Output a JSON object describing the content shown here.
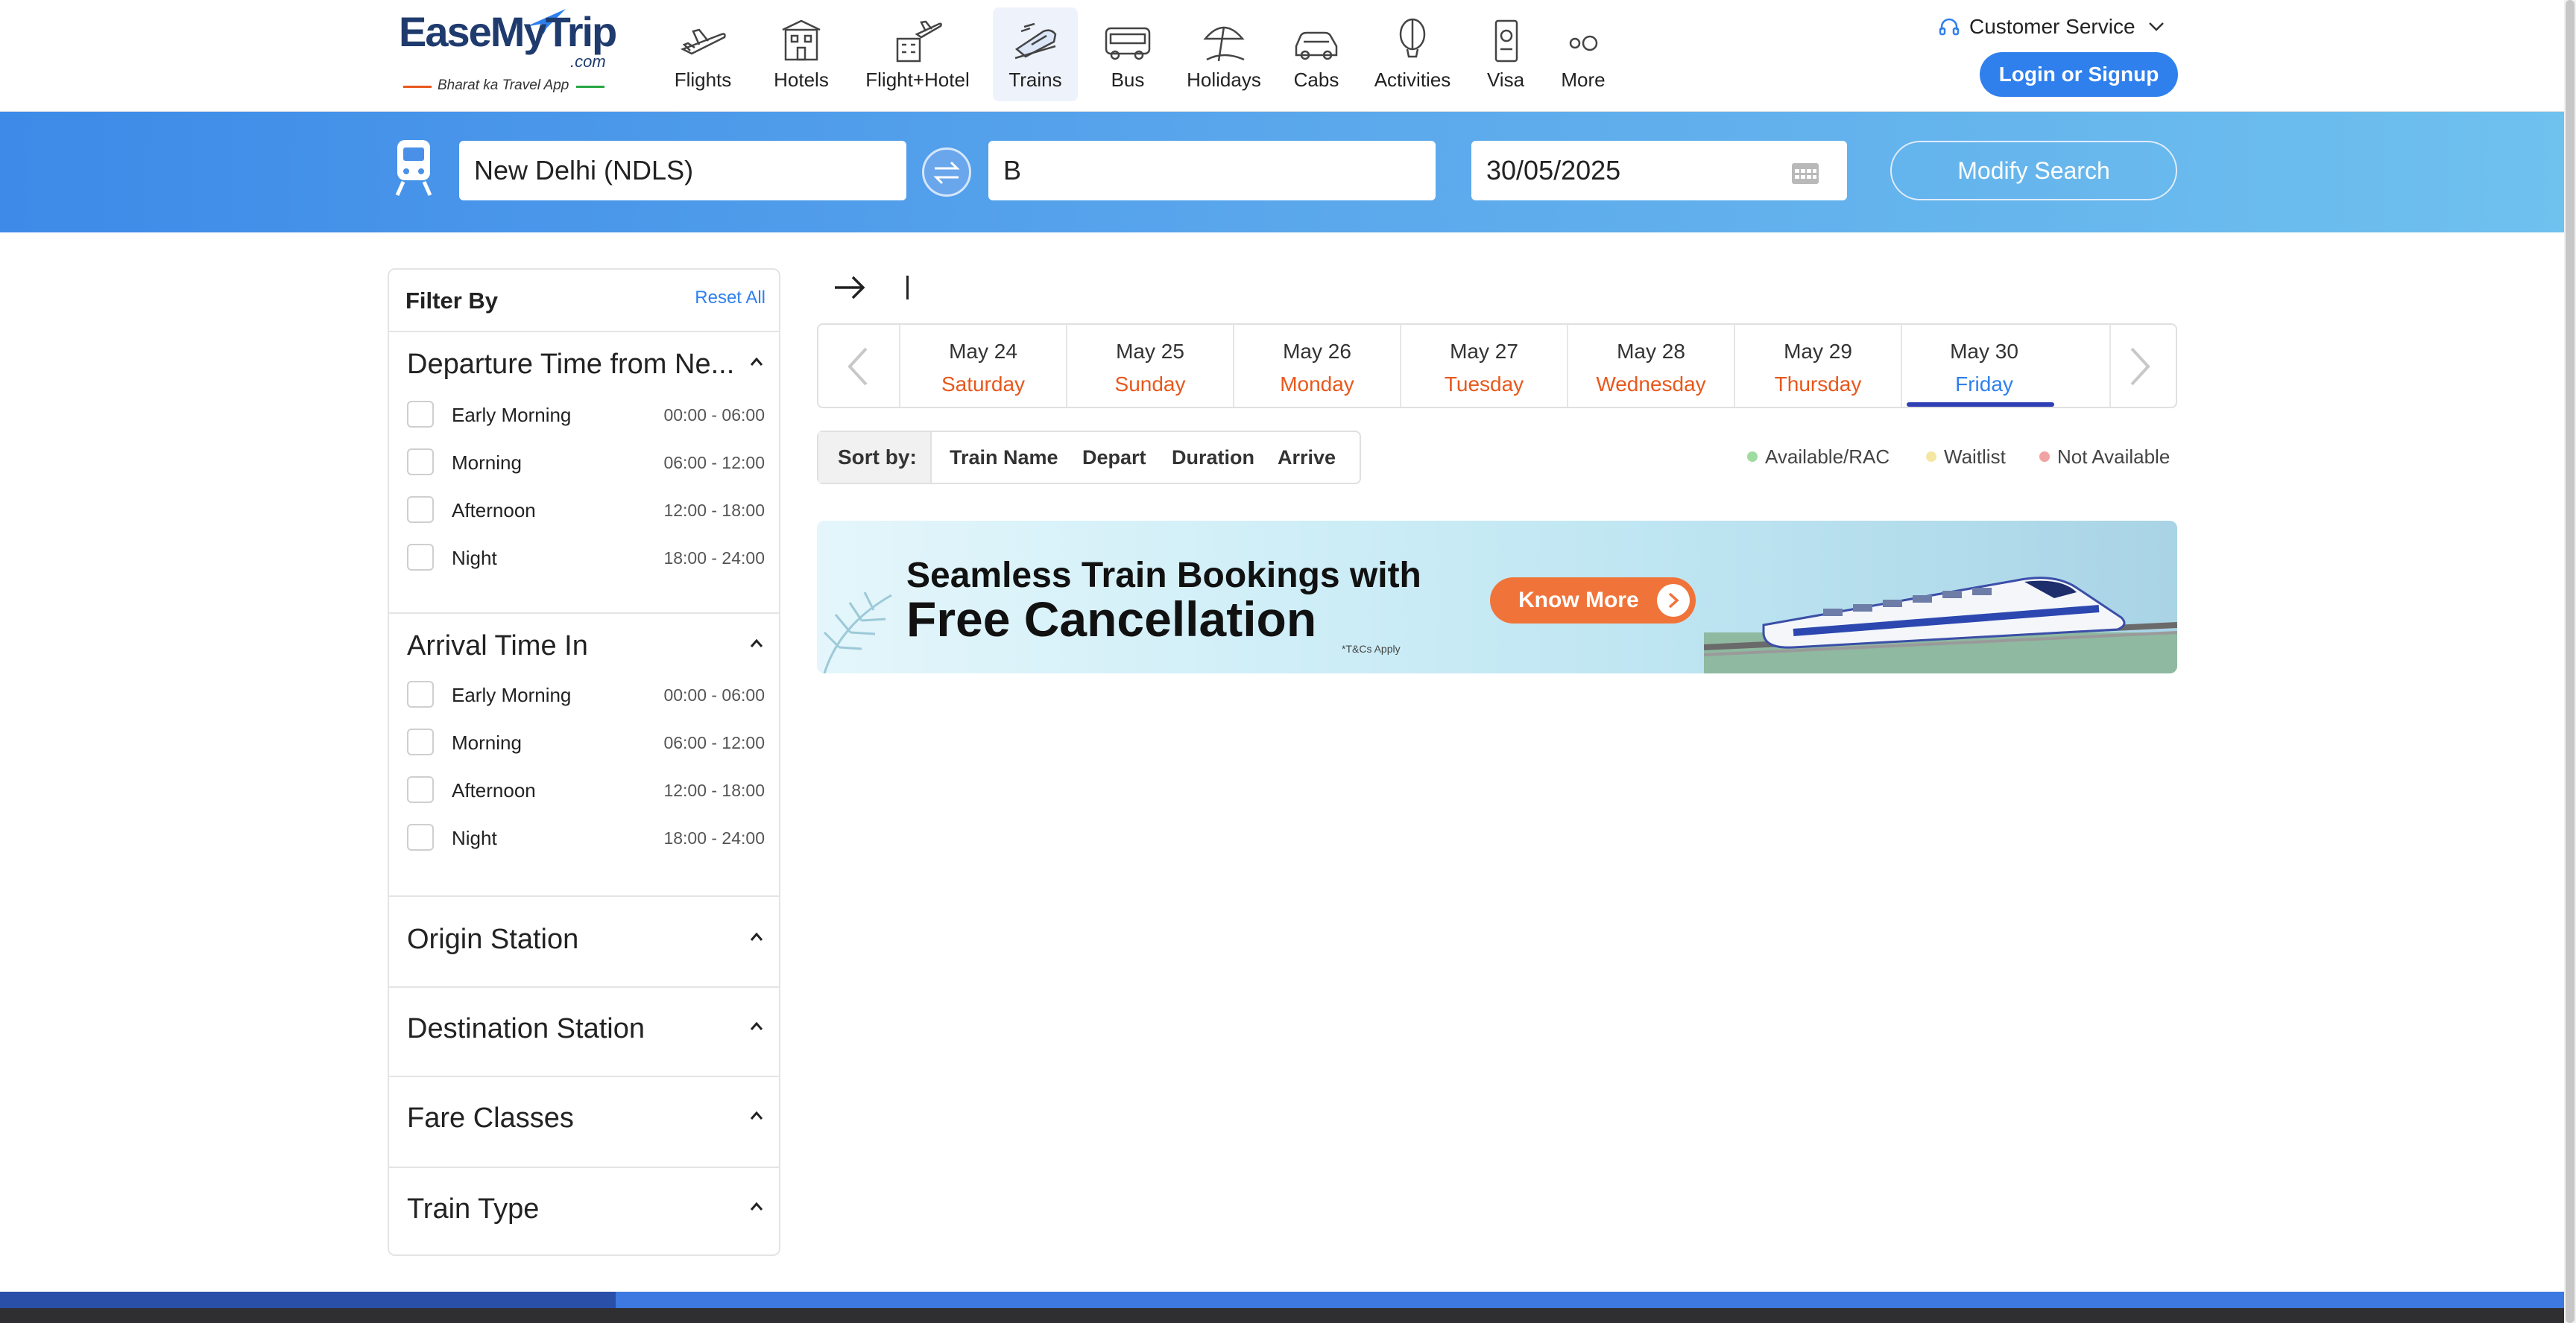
{
  "header": {
    "logo": {
      "brand": "EaseMyTrip",
      "suffix": ".com",
      "tagline": "Bharat ka Travel App"
    },
    "nav": [
      {
        "label": "Flights",
        "icon": "flight-icon"
      },
      {
        "label": "Hotels",
        "icon": "hotel-icon"
      },
      {
        "label": "Flight+Hotel",
        "icon": "flight-hotel-icon"
      },
      {
        "label": "Trains",
        "icon": "train-icon",
        "active": true
      },
      {
        "label": "Bus",
        "icon": "bus-icon"
      },
      {
        "label": "Holidays",
        "icon": "holidays-icon"
      },
      {
        "label": "Cabs",
        "icon": "cab-icon"
      },
      {
        "label": "Activities",
        "icon": "balloon-icon"
      },
      {
        "label": "Visa",
        "icon": "passport-icon"
      },
      {
        "label": "More",
        "icon": "more-icon"
      }
    ],
    "customer_service": "Customer Service",
    "login": "Login or Signup"
  },
  "search": {
    "from": "New Delhi (NDLS)",
    "to": "B",
    "date": "30/05/2025",
    "modify": "Modify Search"
  },
  "filters": {
    "title": "Filter By",
    "reset": "Reset All",
    "departure": {
      "title": "Departure Time from Ne...",
      "options": [
        {
          "label": "Early Morning",
          "range": "00:00 - 06:00"
        },
        {
          "label": "Morning",
          "range": "06:00 - 12:00"
        },
        {
          "label": "Afternoon",
          "range": "12:00 - 18:00"
        },
        {
          "label": "Night",
          "range": "18:00 - 24:00"
        }
      ]
    },
    "arrival": {
      "title": "Arrival Time In",
      "options": [
        {
          "label": "Early Morning",
          "range": "00:00 - 06:00"
        },
        {
          "label": "Morning",
          "range": "06:00 - 12:00"
        },
        {
          "label": "Afternoon",
          "range": "12:00 - 18:00"
        },
        {
          "label": "Night",
          "range": "18:00 - 24:00"
        }
      ]
    },
    "origin": "Origin Station",
    "destination": "Destination Station",
    "fare_classes": "Fare Classes",
    "train_type": "Train Type"
  },
  "dates": [
    {
      "date": "May 24",
      "day": "Saturday"
    },
    {
      "date": "May 25",
      "day": "Sunday"
    },
    {
      "date": "May 26",
      "day": "Monday"
    },
    {
      "date": "May 27",
      "day": "Tuesday"
    },
    {
      "date": "May 28",
      "day": "Wednesday"
    },
    {
      "date": "May 29",
      "day": "Thursday"
    },
    {
      "date": "May 30",
      "day": "Friday",
      "selected": true
    }
  ],
  "sort": {
    "label": "Sort by:",
    "options": [
      "Train Name",
      "Depart",
      "Duration",
      "Arrive"
    ]
  },
  "legend": [
    {
      "label": "Available/RAC",
      "color": "#9fdc9f"
    },
    {
      "label": "Waitlist",
      "color": "#f4e7a3"
    },
    {
      "label": "Not Available",
      "color": "#f1a2a2"
    }
  ],
  "banner": {
    "line1": "Seamless Train Bookings with",
    "line2": "Free Cancellation",
    "cta": "Know More",
    "tc": "*T&Cs Apply"
  },
  "colors": {
    "accent": "#2f80ed",
    "orange": "#e8581c",
    "band_start": "#3d8ae8",
    "band_end": "#6fc1ee"
  }
}
